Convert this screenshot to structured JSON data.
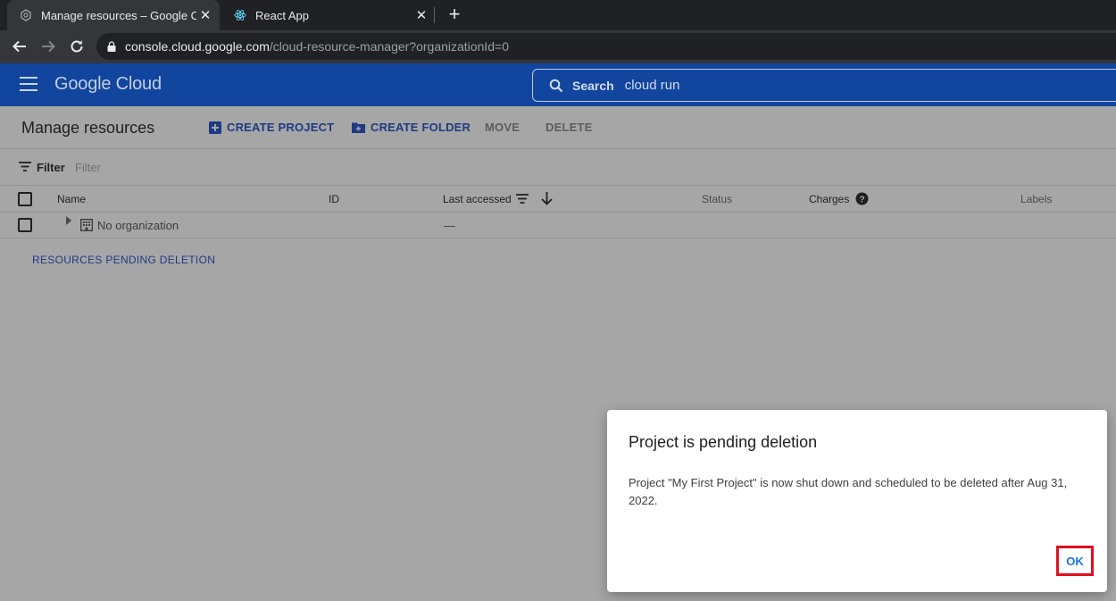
{
  "browser": {
    "tabs": [
      {
        "title": "Manage resources – Google Clou",
        "favicon": "gear-icon",
        "active": true
      },
      {
        "title": "React App",
        "favicon": "react-icon",
        "active": false
      }
    ],
    "new_tab": "+",
    "close_glyph": "✕",
    "url_host": "console.cloud.google.com",
    "url_path": "/cloud-resource-manager?organizationId=0"
  },
  "header": {
    "logo": "Google Cloud",
    "search_label": "Search",
    "search_value": "cloud run"
  },
  "toolbar": {
    "title": "Manage resources",
    "create_project": "CREATE PROJECT",
    "create_folder": "CREATE FOLDER",
    "move": "MOVE",
    "delete": "DELETE"
  },
  "filter": {
    "label": "Filter",
    "placeholder": "Filter"
  },
  "table": {
    "columns": {
      "name": "Name",
      "id": "ID",
      "last_accessed": "Last accessed",
      "status": "Status",
      "charges": "Charges",
      "labels": "Labels"
    },
    "rows": [
      {
        "name": "No organization",
        "last_accessed": "—"
      }
    ]
  },
  "pending_link": "RESOURCES PENDING DELETION",
  "dialog": {
    "title": "Project is pending deletion",
    "body": "Project \"My First Project\" is now shut down and scheduled to be deleted after Aug 31, 2022.",
    "ok": "OK"
  },
  "colors": {
    "header_blue": "#12459d",
    "accent": "#1a73e8",
    "highlight_red": "#e0101e"
  }
}
